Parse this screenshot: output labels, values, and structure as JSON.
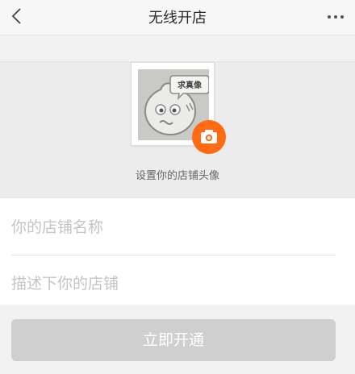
{
  "nav": {
    "title": "无线开店",
    "back_icon": "chevron-left-icon",
    "more_icon": "ellipsis-icon"
  },
  "avatar": {
    "bubble_text": "求真像",
    "caption": "设置你的店铺头像",
    "camera_icon": "camera-icon",
    "badge_color": "#ff6a13"
  },
  "form": {
    "shop_name_placeholder": "你的店铺名称",
    "shop_name_value": "",
    "shop_desc_placeholder": "描述下你的店铺",
    "shop_desc_value": ""
  },
  "submit": {
    "label": "立即开通",
    "state": "disabled"
  }
}
